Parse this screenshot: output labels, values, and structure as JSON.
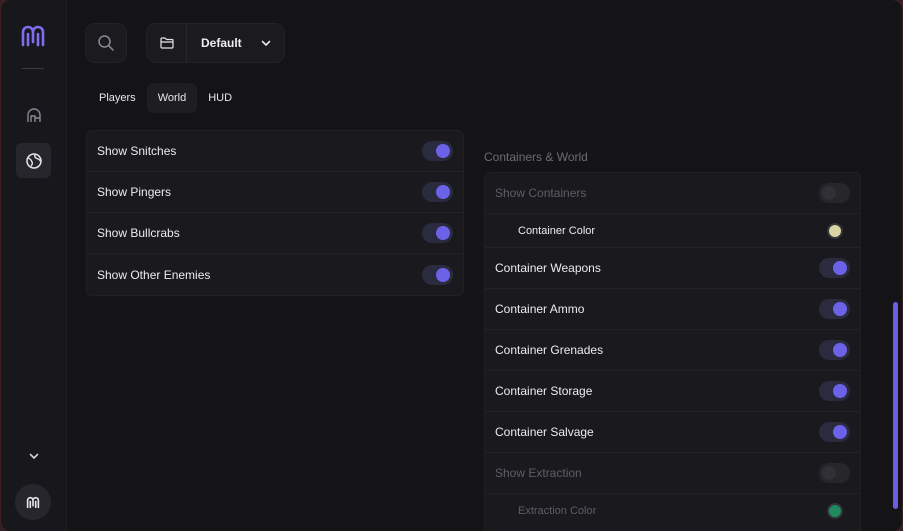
{
  "header": {
    "profile_name": "Default"
  },
  "tabs": [
    {
      "label": "Players",
      "active": false
    },
    {
      "label": "World",
      "active": true
    },
    {
      "label": "HUD",
      "active": false
    }
  ],
  "left_panel": {
    "rows": [
      {
        "label": "Show Snitches",
        "enabled": true
      },
      {
        "label": "Show Pingers",
        "enabled": true
      },
      {
        "label": "Show Bullcrabs",
        "enabled": true
      },
      {
        "label": "Show Other Enemies",
        "enabled": true
      }
    ]
  },
  "right_panel": {
    "section_title": "Containers & World",
    "rows": [
      {
        "label": "Show Containers",
        "enabled": false
      },
      {
        "label": "Container Color",
        "color": "#d8d4a4"
      },
      {
        "label": "Container Weapons",
        "enabled": true
      },
      {
        "label": "Container Ammo",
        "enabled": true
      },
      {
        "label": "Container Grenades",
        "enabled": true
      },
      {
        "label": "Container Storage",
        "enabled": true
      },
      {
        "label": "Container Salvage",
        "enabled": true
      },
      {
        "label": "Show Extraction",
        "enabled": false
      },
      {
        "label": "Extraction Color",
        "color": "#1f8a5f"
      }
    ]
  },
  "colors": {
    "accent": "#6c62e8",
    "background": "#141417"
  },
  "icons": {
    "sidebar": [
      "helmet-icon",
      "globe-icon",
      "chevron-down-icon"
    ],
    "header": [
      "search-icon",
      "folder-icon",
      "chevron-down-icon"
    ]
  }
}
